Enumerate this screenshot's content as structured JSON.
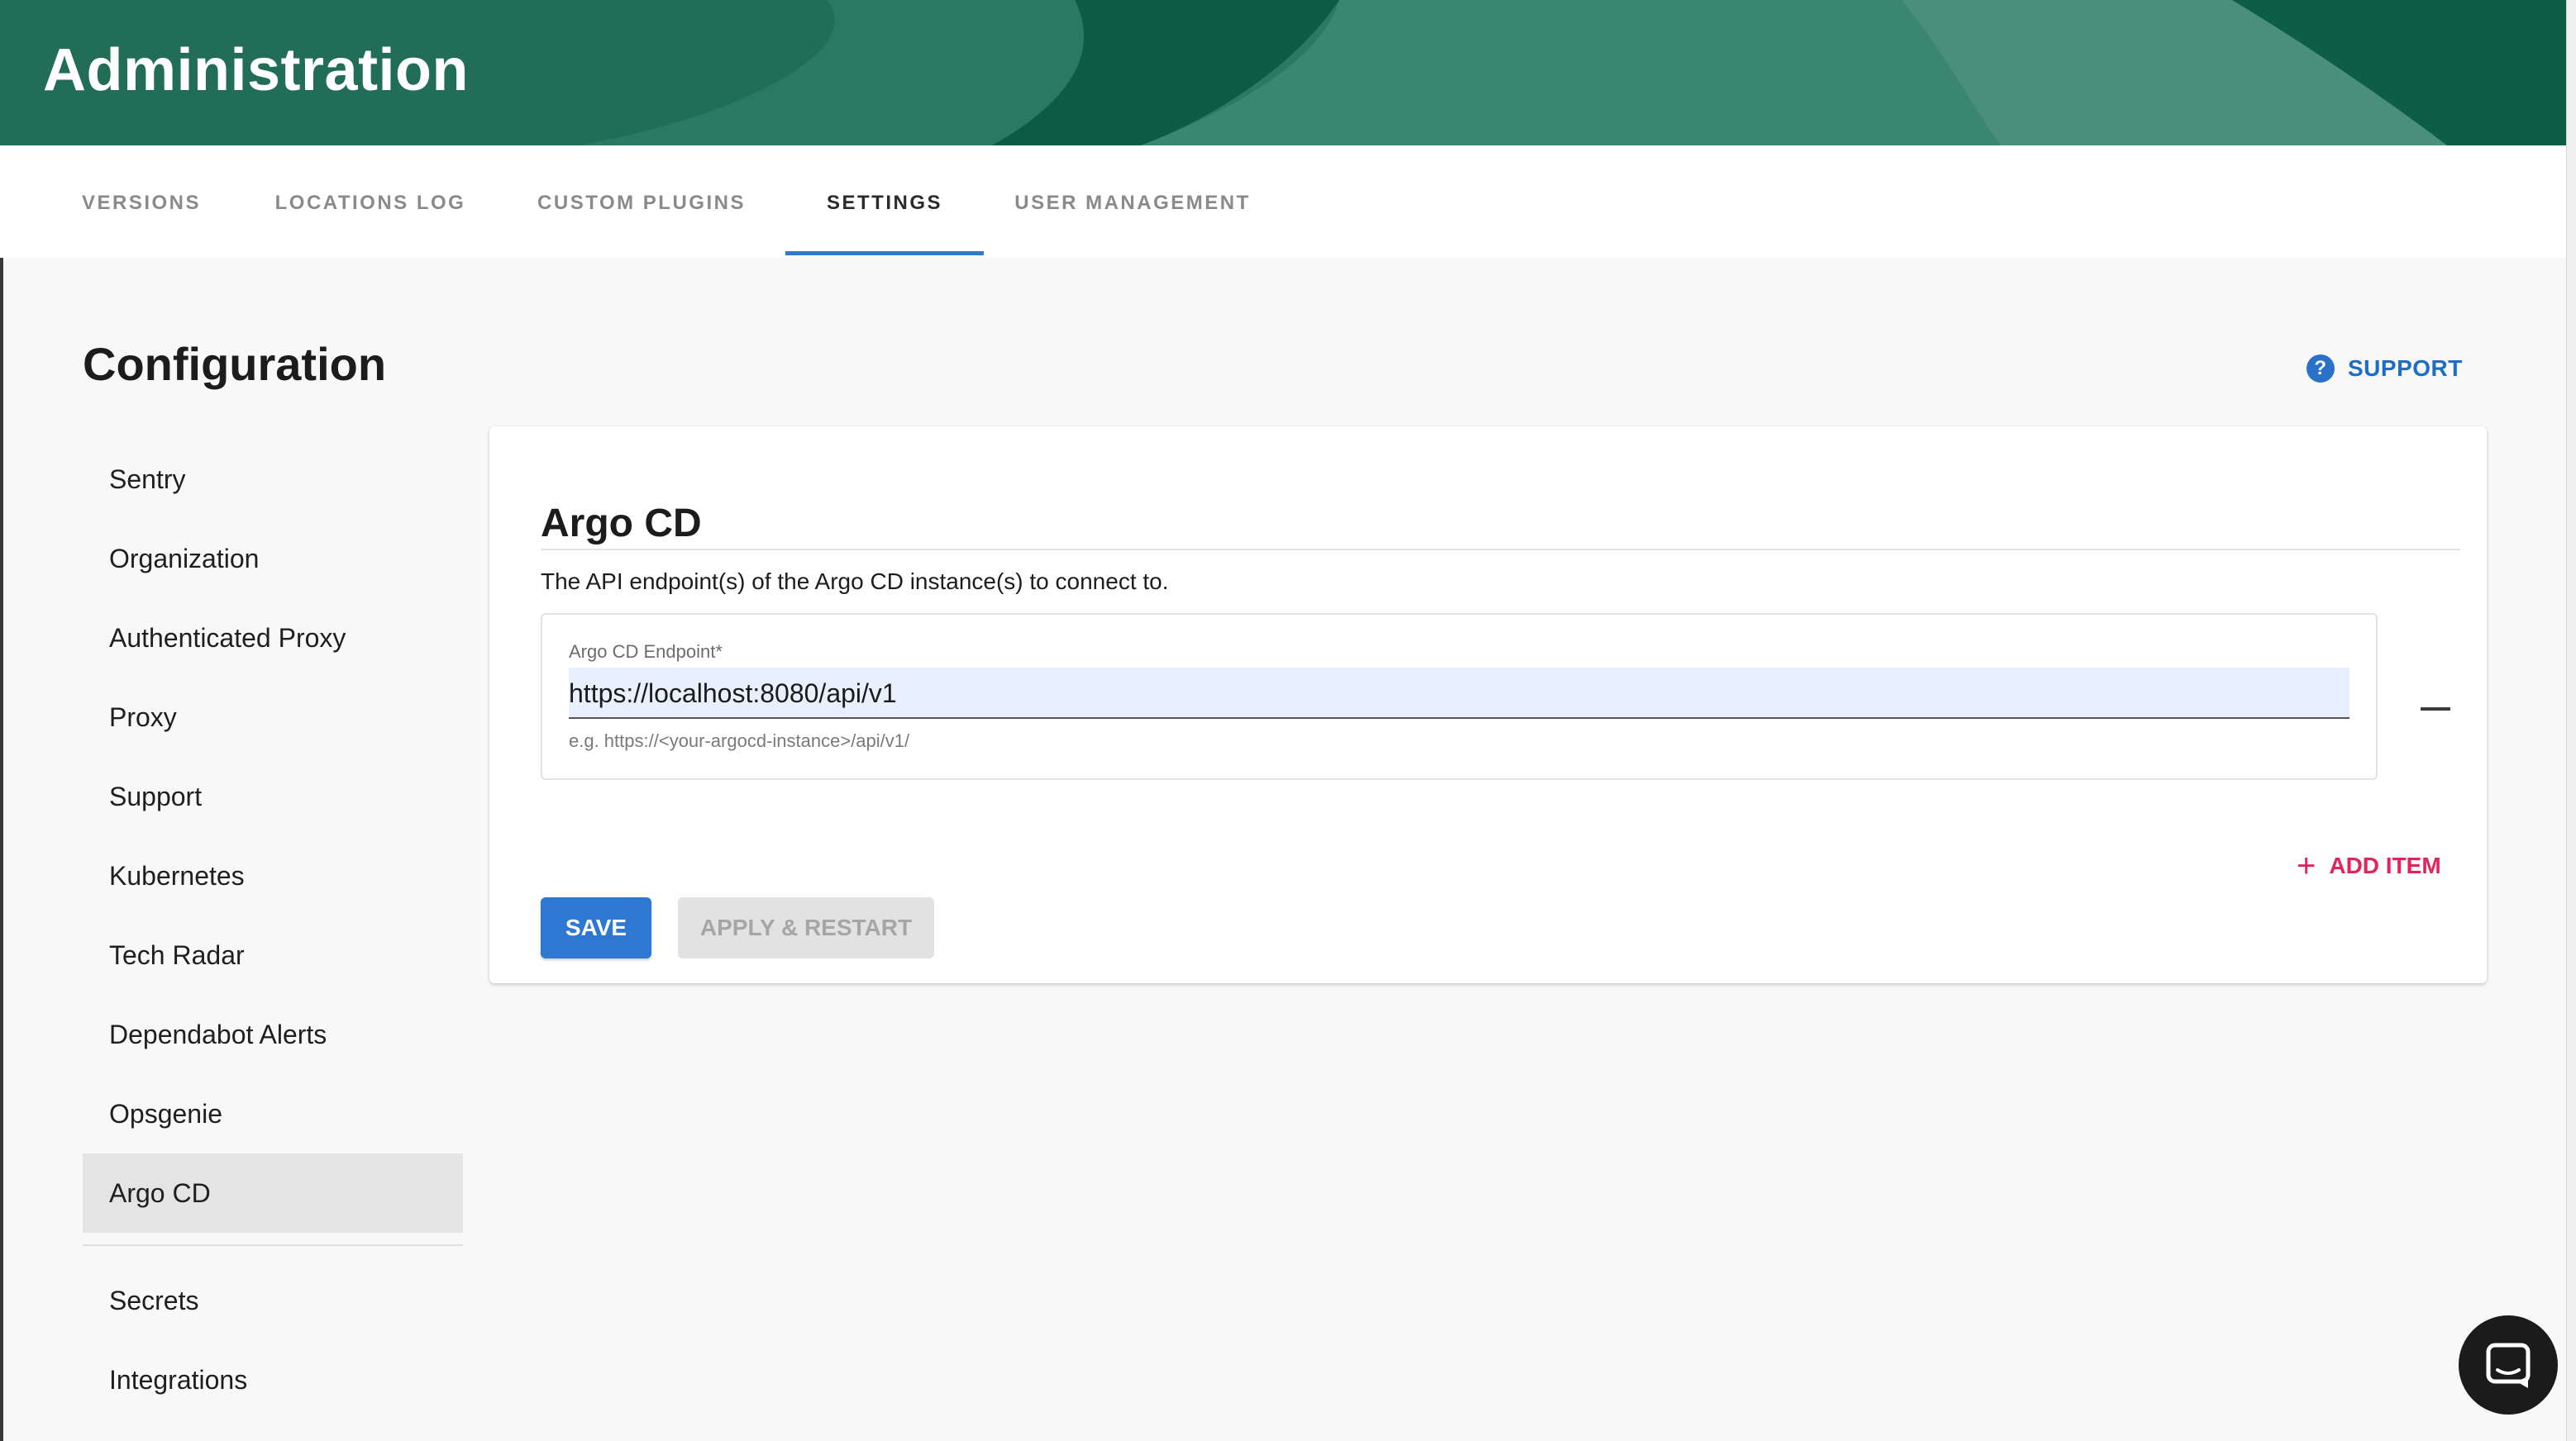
{
  "header": {
    "title": "Administration"
  },
  "tabs": [
    {
      "label": "VERSIONS"
    },
    {
      "label": "LOCATIONS LOG"
    },
    {
      "label": "CUSTOM PLUGINS"
    },
    {
      "label": "SETTINGS",
      "active": true
    },
    {
      "label": "USER MANAGEMENT"
    }
  ],
  "page": {
    "title": "Configuration",
    "support_label": "SUPPORT"
  },
  "sidebar": {
    "items": [
      {
        "label": "Sentry"
      },
      {
        "label": "Organization"
      },
      {
        "label": "Authenticated Proxy"
      },
      {
        "label": "Proxy"
      },
      {
        "label": "Support"
      },
      {
        "label": "Kubernetes"
      },
      {
        "label": "Tech Radar"
      },
      {
        "label": "Dependabot Alerts"
      },
      {
        "label": "Opsgenie"
      },
      {
        "label": "Argo CD",
        "active": true
      },
      {
        "label": "Secrets"
      },
      {
        "label": "Integrations"
      }
    ]
  },
  "card": {
    "title": "Argo CD",
    "description": "The API endpoint(s) of the Argo CD instance(s) to connect to.",
    "endpoint": {
      "label": "Argo CD Endpoint*",
      "value": "https://localhost:8080/api/v1",
      "helper": "e.g. https://<your-argocd-instance>/api/v1/"
    },
    "add_item_label": "ADD ITEM",
    "save_label": "SAVE",
    "apply_label": "APPLY & RESTART"
  },
  "colors": {
    "header_green": "#1f6a55",
    "primary_blue": "#2f78d1",
    "accent_pink": "#e0245e"
  },
  "icons": {
    "support": "help-circle-icon",
    "add": "plus-icon",
    "remove": "minus-icon",
    "chat": "chat-bubble-icon"
  }
}
